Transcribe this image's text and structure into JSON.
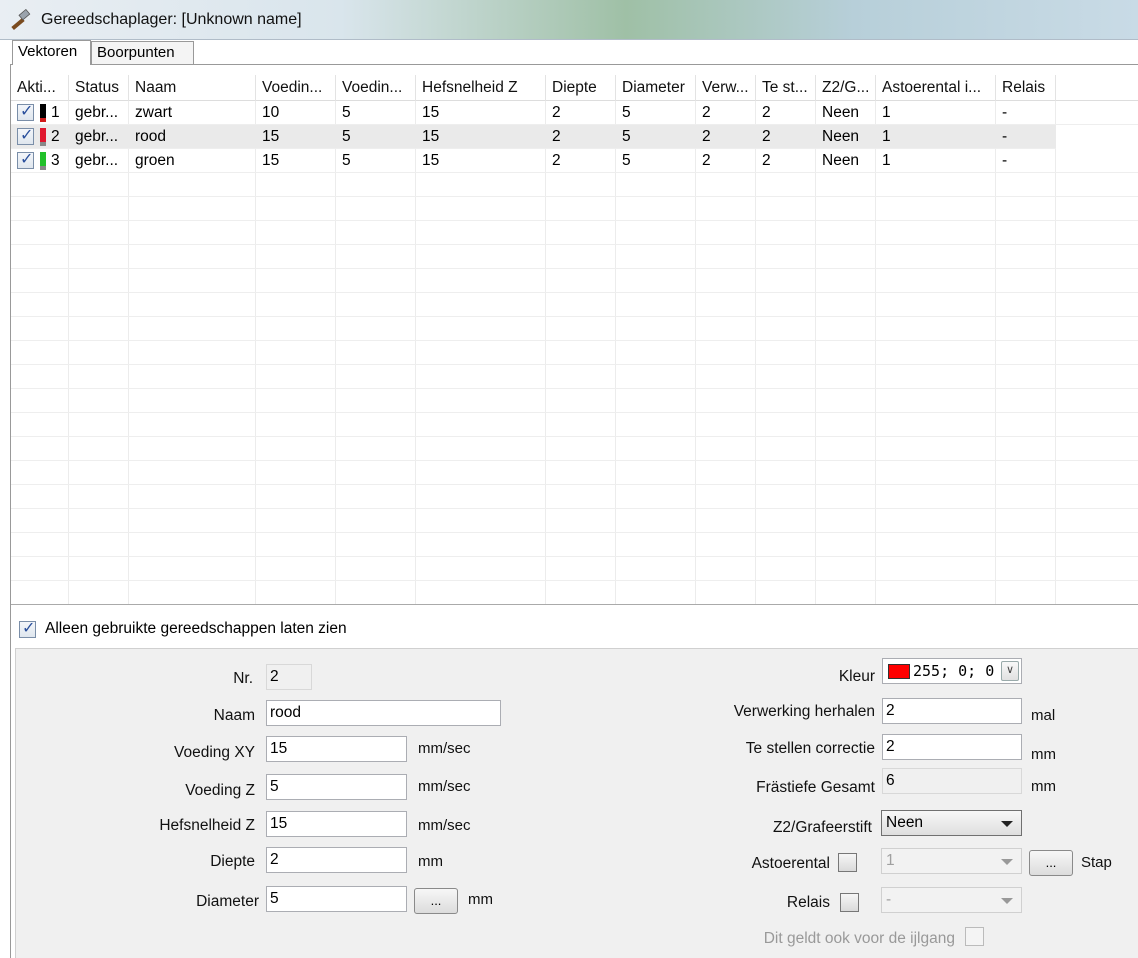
{
  "window": {
    "title": "Gereedschaplager: [Unknown name]"
  },
  "tabs": [
    {
      "label": "Vektoren",
      "active": true
    },
    {
      "label": "Boorpunten",
      "active": false
    }
  ],
  "grid": {
    "columns": [
      "Akti...",
      "Status",
      "Naam",
      "Voedin...",
      "Voedin...",
      "Hefsnelheid Z",
      "Diepte",
      "Diameter",
      "Verw...",
      "Te st...",
      "Z2/G...",
      "Astoerental i...",
      "Relais"
    ],
    "rows": [
      {
        "active": true,
        "nr": "1",
        "color": "#000000",
        "under": "#d11a1a",
        "status": "gebr...",
        "naam": "zwart",
        "voeding_xy": "10",
        "voeding_z": "5",
        "hefsnelheid": "15",
        "diepte": "2",
        "diameter": "5",
        "verwerking": "2",
        "te_stellen": "2",
        "z2": "Neen",
        "astoerental": "1",
        "relais": "-"
      },
      {
        "active": true,
        "nr": "2",
        "color": "#e0172e",
        "under": "#888888",
        "status": "gebr...",
        "naam": "rood",
        "voeding_xy": "15",
        "voeding_z": "5",
        "hefsnelheid": "15",
        "diepte": "2",
        "diameter": "5",
        "verwerking": "2",
        "te_stellen": "2",
        "z2": "Neen",
        "astoerental": "1",
        "relais": "-"
      },
      {
        "active": true,
        "nr": "3",
        "color": "#22c02a",
        "under": "#888888",
        "status": "gebr...",
        "naam": "groen",
        "voeding_xy": "15",
        "voeding_z": "5",
        "hefsnelheid": "15",
        "diepte": "2",
        "diameter": "5",
        "verwerking": "2",
        "te_stellen": "2",
        "z2": "Neen",
        "astoerental": "1",
        "relais": "-"
      }
    ]
  },
  "only_used": {
    "label": "Alleen gebruikte gereedschappen laten zien",
    "checked": true
  },
  "props": {
    "nr": {
      "label": "Nr.",
      "value": "2"
    },
    "naam": {
      "label": "Naam",
      "value": "rood"
    },
    "voeding_xy": {
      "label": "Voeding XY",
      "value": "15",
      "unit": "mm/sec"
    },
    "voeding_z": {
      "label": "Voeding Z",
      "value": "5",
      "unit": "mm/sec"
    },
    "hefsnelheid": {
      "label": "Hefsnelheid Z",
      "value": "15",
      "unit": "mm/sec"
    },
    "diepte": {
      "label": "Diepte",
      "value": "2",
      "unit": "mm"
    },
    "diameter": {
      "label": "Diameter",
      "value": "5",
      "unit": "mm",
      "button": "..."
    },
    "kleur": {
      "label": "Kleur",
      "value": "255; 0; 0",
      "swatch": "#ff0000"
    },
    "verwerking": {
      "label": "Verwerking herhalen",
      "value": "2",
      "unit": "mal"
    },
    "correctie": {
      "label": "Te stellen correctie",
      "value": "2",
      "unit": "mm"
    },
    "frastiefe": {
      "label": "Frästiefe Gesamt",
      "value": "6",
      "unit": "mm"
    },
    "z2": {
      "label": "Z2/Grafeerstift",
      "value": "Neen"
    },
    "astoerental": {
      "label": "Astoerental",
      "value": "1",
      "button": "...",
      "button_label": "Stap"
    },
    "relais": {
      "label": "Relais",
      "value": "-"
    },
    "ijlgang": {
      "label": "Dit geldt ook voor de ijlgang"
    }
  }
}
